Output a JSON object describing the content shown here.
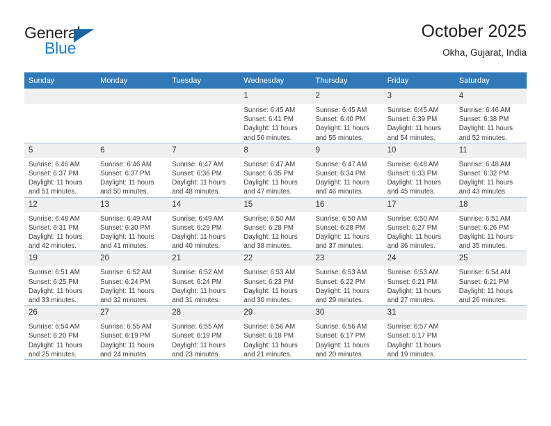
{
  "brand": {
    "line1": "General",
    "line2": "Blue",
    "triangle_color": "#19639f",
    "blue_color": "#1b7cc4"
  },
  "header": {
    "title": "October 2025",
    "subtitle": "Okha, Gujarat, India",
    "header_bg": "#3179b8"
  },
  "weekdays": [
    "Sunday",
    "Monday",
    "Tuesday",
    "Wednesday",
    "Thursday",
    "Friday",
    "Saturday"
  ],
  "weeks": [
    [
      {
        "day": "",
        "empty": true,
        "sunrise": "",
        "sunset": "",
        "daylight1": "",
        "daylight2": ""
      },
      {
        "day": "",
        "empty": true,
        "sunrise": "",
        "sunset": "",
        "daylight1": "",
        "daylight2": ""
      },
      {
        "day": "",
        "empty": true,
        "sunrise": "",
        "sunset": "",
        "daylight1": "",
        "daylight2": ""
      },
      {
        "day": "1",
        "empty": false,
        "sunrise": "Sunrise: 6:45 AM",
        "sunset": "Sunset: 6:41 PM",
        "daylight1": "Daylight: 11 hours",
        "daylight2": "and 56 minutes."
      },
      {
        "day": "2",
        "empty": false,
        "sunrise": "Sunrise: 6:45 AM",
        "sunset": "Sunset: 6:40 PM",
        "daylight1": "Daylight: 11 hours",
        "daylight2": "and 55 minutes."
      },
      {
        "day": "3",
        "empty": false,
        "sunrise": "Sunrise: 6:45 AM",
        "sunset": "Sunset: 6:39 PM",
        "daylight1": "Daylight: 11 hours",
        "daylight2": "and 54 minutes."
      },
      {
        "day": "4",
        "empty": false,
        "sunrise": "Sunrise: 6:46 AM",
        "sunset": "Sunset: 6:38 PM",
        "daylight1": "Daylight: 11 hours",
        "daylight2": "and 52 minutes."
      }
    ],
    [
      {
        "day": "5",
        "empty": false,
        "sunrise": "Sunrise: 6:46 AM",
        "sunset": "Sunset: 6:37 PM",
        "daylight1": "Daylight: 11 hours",
        "daylight2": "and 51 minutes."
      },
      {
        "day": "6",
        "empty": false,
        "sunrise": "Sunrise: 6:46 AM",
        "sunset": "Sunset: 6:37 PM",
        "daylight1": "Daylight: 11 hours",
        "daylight2": "and 50 minutes."
      },
      {
        "day": "7",
        "empty": false,
        "sunrise": "Sunrise: 6:47 AM",
        "sunset": "Sunset: 6:36 PM",
        "daylight1": "Daylight: 11 hours",
        "daylight2": "and 48 minutes."
      },
      {
        "day": "8",
        "empty": false,
        "sunrise": "Sunrise: 6:47 AM",
        "sunset": "Sunset: 6:35 PM",
        "daylight1": "Daylight: 11 hours",
        "daylight2": "and 47 minutes."
      },
      {
        "day": "9",
        "empty": false,
        "sunrise": "Sunrise: 6:47 AM",
        "sunset": "Sunset: 6:34 PM",
        "daylight1": "Daylight: 11 hours",
        "daylight2": "and 46 minutes."
      },
      {
        "day": "10",
        "empty": false,
        "sunrise": "Sunrise: 6:48 AM",
        "sunset": "Sunset: 6:33 PM",
        "daylight1": "Daylight: 11 hours",
        "daylight2": "and 45 minutes."
      },
      {
        "day": "11",
        "empty": false,
        "sunrise": "Sunrise: 6:48 AM",
        "sunset": "Sunset: 6:32 PM",
        "daylight1": "Daylight: 11 hours",
        "daylight2": "and 43 minutes."
      }
    ],
    [
      {
        "day": "12",
        "empty": false,
        "sunrise": "Sunrise: 6:48 AM",
        "sunset": "Sunset: 6:31 PM",
        "daylight1": "Daylight: 11 hours",
        "daylight2": "and 42 minutes."
      },
      {
        "day": "13",
        "empty": false,
        "sunrise": "Sunrise: 6:49 AM",
        "sunset": "Sunset: 6:30 PM",
        "daylight1": "Daylight: 11 hours",
        "daylight2": "and 41 minutes."
      },
      {
        "day": "14",
        "empty": false,
        "sunrise": "Sunrise: 6:49 AM",
        "sunset": "Sunset: 6:29 PM",
        "daylight1": "Daylight: 11 hours",
        "daylight2": "and 40 minutes."
      },
      {
        "day": "15",
        "empty": false,
        "sunrise": "Sunrise: 6:50 AM",
        "sunset": "Sunset: 6:28 PM",
        "daylight1": "Daylight: 11 hours",
        "daylight2": "and 38 minutes."
      },
      {
        "day": "16",
        "empty": false,
        "sunrise": "Sunrise: 6:50 AM",
        "sunset": "Sunset: 6:28 PM",
        "daylight1": "Daylight: 11 hours",
        "daylight2": "and 37 minutes."
      },
      {
        "day": "17",
        "empty": false,
        "sunrise": "Sunrise: 6:50 AM",
        "sunset": "Sunset: 6:27 PM",
        "daylight1": "Daylight: 11 hours",
        "daylight2": "and 36 minutes."
      },
      {
        "day": "18",
        "empty": false,
        "sunrise": "Sunrise: 6:51 AM",
        "sunset": "Sunset: 6:26 PM",
        "daylight1": "Daylight: 11 hours",
        "daylight2": "and 35 minutes."
      }
    ],
    [
      {
        "day": "19",
        "empty": false,
        "sunrise": "Sunrise: 6:51 AM",
        "sunset": "Sunset: 6:25 PM",
        "daylight1": "Daylight: 11 hours",
        "daylight2": "and 33 minutes."
      },
      {
        "day": "20",
        "empty": false,
        "sunrise": "Sunrise: 6:52 AM",
        "sunset": "Sunset: 6:24 PM",
        "daylight1": "Daylight: 11 hours",
        "daylight2": "and 32 minutes."
      },
      {
        "day": "21",
        "empty": false,
        "sunrise": "Sunrise: 6:52 AM",
        "sunset": "Sunset: 6:24 PM",
        "daylight1": "Daylight: 11 hours",
        "daylight2": "and 31 minutes."
      },
      {
        "day": "22",
        "empty": false,
        "sunrise": "Sunrise: 6:53 AM",
        "sunset": "Sunset: 6:23 PM",
        "daylight1": "Daylight: 11 hours",
        "daylight2": "and 30 minutes."
      },
      {
        "day": "23",
        "empty": false,
        "sunrise": "Sunrise: 6:53 AM",
        "sunset": "Sunset: 6:22 PM",
        "daylight1": "Daylight: 11 hours",
        "daylight2": "and 29 minutes."
      },
      {
        "day": "24",
        "empty": false,
        "sunrise": "Sunrise: 6:53 AM",
        "sunset": "Sunset: 6:21 PM",
        "daylight1": "Daylight: 11 hours",
        "daylight2": "and 27 minutes."
      },
      {
        "day": "25",
        "empty": false,
        "sunrise": "Sunrise: 6:54 AM",
        "sunset": "Sunset: 6:21 PM",
        "daylight1": "Daylight: 11 hours",
        "daylight2": "and 26 minutes."
      }
    ],
    [
      {
        "day": "26",
        "empty": false,
        "sunrise": "Sunrise: 6:54 AM",
        "sunset": "Sunset: 6:20 PM",
        "daylight1": "Daylight: 11 hours",
        "daylight2": "and 25 minutes."
      },
      {
        "day": "27",
        "empty": false,
        "sunrise": "Sunrise: 6:55 AM",
        "sunset": "Sunset: 6:19 PM",
        "daylight1": "Daylight: 11 hours",
        "daylight2": "and 24 minutes."
      },
      {
        "day": "28",
        "empty": false,
        "sunrise": "Sunrise: 6:55 AM",
        "sunset": "Sunset: 6:19 PM",
        "daylight1": "Daylight: 11 hours",
        "daylight2": "and 23 minutes."
      },
      {
        "day": "29",
        "empty": false,
        "sunrise": "Sunrise: 6:56 AM",
        "sunset": "Sunset: 6:18 PM",
        "daylight1": "Daylight: 11 hours",
        "daylight2": "and 21 minutes."
      },
      {
        "day": "30",
        "empty": false,
        "sunrise": "Sunrise: 6:56 AM",
        "sunset": "Sunset: 6:17 PM",
        "daylight1": "Daylight: 11 hours",
        "daylight2": "and 20 minutes."
      },
      {
        "day": "31",
        "empty": false,
        "sunrise": "Sunrise: 6:57 AM",
        "sunset": "Sunset: 6:17 PM",
        "daylight1": "Daylight: 11 hours",
        "daylight2": "and 19 minutes."
      },
      {
        "day": "",
        "empty": true,
        "sunrise": "",
        "sunset": "",
        "daylight1": "",
        "daylight2": ""
      }
    ]
  ]
}
